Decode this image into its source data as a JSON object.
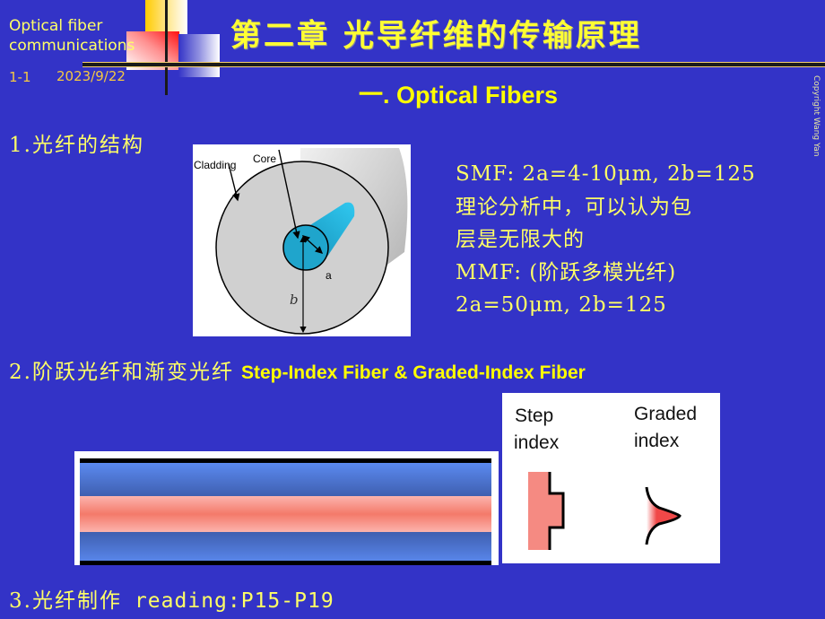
{
  "header": {
    "course_title_line1": "Optical fiber",
    "course_title_line2": "communications",
    "slide_number": "1-1",
    "date": "2023/9/22",
    "chapter_title": "第二章  光导纤维的传输原理",
    "section_title": "一. Optical Fibers",
    "copyright": "Copyright Wang Yan"
  },
  "section1": {
    "heading": "1.光纤的结构",
    "figure": {
      "cladding_label": "Cladding",
      "core_label": "Core",
      "radius_core_label": "a",
      "radius_cladding_label": "b",
      "core_color": "#1fb0d8",
      "cladding_color": "#d0d0d0"
    },
    "notes": [
      "SMF: 2a=4-10μm, 2b=125",
      "理论分析中，可以认为包",
      "层是无限大的",
      "MMF: (阶跃多模光纤)",
      "2a=50μm, 2b=125"
    ]
  },
  "section2": {
    "heading_cn": "2.阶跃光纤和渐变光纤",
    "heading_en": "Step-Index Fiber & Graded-Index Fiber",
    "profile_colors": {
      "cladding": "#5b8af0",
      "core": "#f47a6a"
    },
    "index_figure": {
      "step_label_line1": "Step",
      "step_label_line2": "index",
      "graded_label_line1": "Graded",
      "graded_label_line2": "index"
    }
  },
  "section3": {
    "heading_cn": "3.光纤制作",
    "heading_en": "reading:P15-P19"
  },
  "colors": {
    "background": "#3333c7",
    "title_yellow": "#ffff33"
  }
}
